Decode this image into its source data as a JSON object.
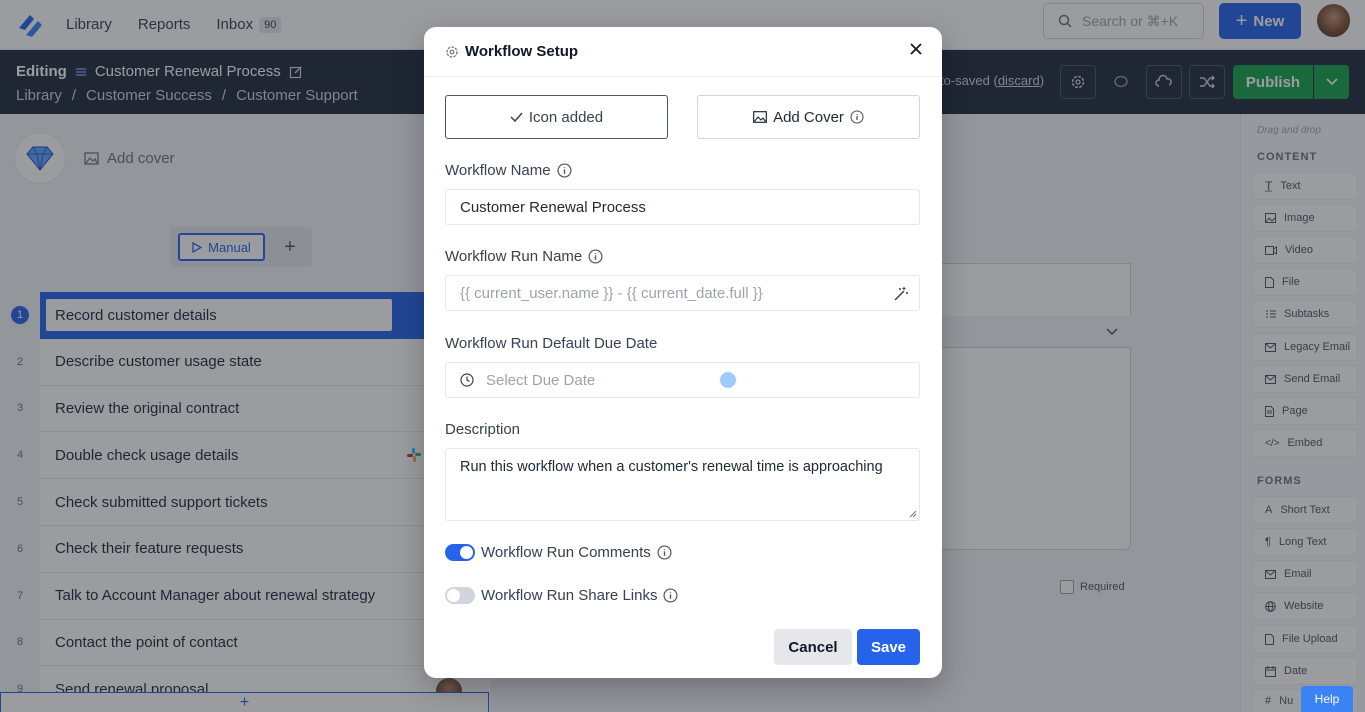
{
  "topnav": {
    "links": [
      {
        "label": "Library"
      },
      {
        "label": "Reports"
      },
      {
        "label": "Inbox",
        "badge": "90"
      }
    ],
    "search_placeholder": "Search or ⌘+K",
    "new_label": "New"
  },
  "editor": {
    "editing_label": "Editing",
    "workflow_title": "Customer Renewal Process",
    "breadcrumbs": [
      "Library",
      "/",
      "Customer Success",
      "/",
      "Customer Support"
    ],
    "autosave_prefix": "to-saved (",
    "autosave_link": "discard",
    "autosave_suffix": ")",
    "publish_label": "Publish"
  },
  "canvas": {
    "add_cover_label": "Add cover",
    "manual_label": "Manual",
    "tasks": [
      {
        "num": "1",
        "label": "Record customer details"
      },
      {
        "num": "2",
        "label": "Describe customer usage state"
      },
      {
        "num": "3",
        "label": "Review the original contract"
      },
      {
        "num": "4",
        "label": "Double check usage details"
      },
      {
        "num": "5",
        "label": "Check submitted support tickets"
      },
      {
        "num": "6",
        "label": "Check their feature requests"
      },
      {
        "num": "7",
        "label": "Talk to Account Manager about renewal strategy"
      },
      {
        "num": "8",
        "label": "Contact the point of contact"
      },
      {
        "num": "9",
        "label": "Send renewal proposal"
      }
    ],
    "required_label": "Required"
  },
  "sidebar": {
    "hint": "Drag and drop",
    "content_heading": "CONTENT",
    "content_items": [
      "Text",
      "Image",
      "Video",
      "File",
      "Subtasks",
      "Legacy Email",
      "Send Email",
      "Page",
      "Embed"
    ],
    "forms_heading": "FORMS",
    "form_items": [
      "Short Text",
      "Long Text",
      "Email",
      "Website",
      "File Upload",
      "Date",
      "Nu"
    ],
    "help_label": "Help"
  },
  "modal": {
    "title": "Workflow Setup",
    "icon_added_label": "Icon added",
    "add_cover_label": "Add Cover",
    "name_label": "Workflow Name",
    "name_value": "Customer Renewal Process",
    "run_name_label": "Workflow Run Name",
    "run_name_placeholder": "{{ current_user.name }} - {{ current_date.full }}",
    "due_label": "Workflow Run Default Due Date",
    "due_placeholder": "Select Due Date",
    "desc_label": "Description",
    "desc_value": "Run this workflow when a customer's renewal time is approaching",
    "comments_label": "Workflow Run Comments",
    "comments_on": true,
    "share_label": "Workflow Run Share Links",
    "share_on": false,
    "cancel_label": "Cancel",
    "save_label": "Save"
  },
  "colors": {
    "primary": "#2563eb",
    "publish": "#16a34a",
    "editbar": "#1f2a3c"
  }
}
